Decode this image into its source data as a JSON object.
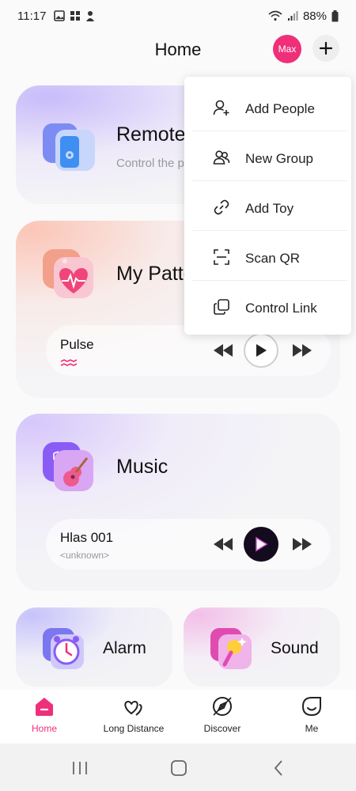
{
  "status_bar": {
    "time": "11:17",
    "battery": "88%",
    "left_icons": [
      "image-icon",
      "grid-icon",
      "person-icon"
    ],
    "right_icons": [
      "wifi-icon",
      "signal-icon",
      "battery-icon"
    ]
  },
  "header": {
    "title": "Home",
    "avatar_label": "Max",
    "add_icon": "plus-icon"
  },
  "cards": {
    "remote": {
      "title": "Remote",
      "subtitle": "Control the p"
    },
    "pattern": {
      "title": "My Patte",
      "song": "Pulse"
    },
    "music": {
      "title": "Music",
      "song": "Hlas 001",
      "artist": "<unknown>"
    }
  },
  "minis": {
    "alarm": "Alarm",
    "sound": "Sound"
  },
  "menu": {
    "items": [
      {
        "label": "Add People",
        "icon": "add-person-icon"
      },
      {
        "label": "New Group",
        "icon": "group-icon"
      },
      {
        "label": "Add Toy",
        "icon": "link-icon"
      },
      {
        "label": "Scan QR",
        "icon": "scan-icon"
      },
      {
        "label": "Control Link",
        "icon": "copy-link-icon"
      }
    ]
  },
  "bottom_nav": {
    "items": [
      {
        "label": "Home",
        "icon": "home-icon",
        "active": true
      },
      {
        "label": "Long Distance",
        "icon": "hearts-icon",
        "active": false
      },
      {
        "label": "Discover",
        "icon": "compass-icon",
        "active": false
      },
      {
        "label": "Me",
        "icon": "smile-icon",
        "active": false
      }
    ]
  },
  "colors": {
    "accent": "#ef2f7a",
    "purple": "#8a5cf6",
    "background": "#fafafa"
  }
}
